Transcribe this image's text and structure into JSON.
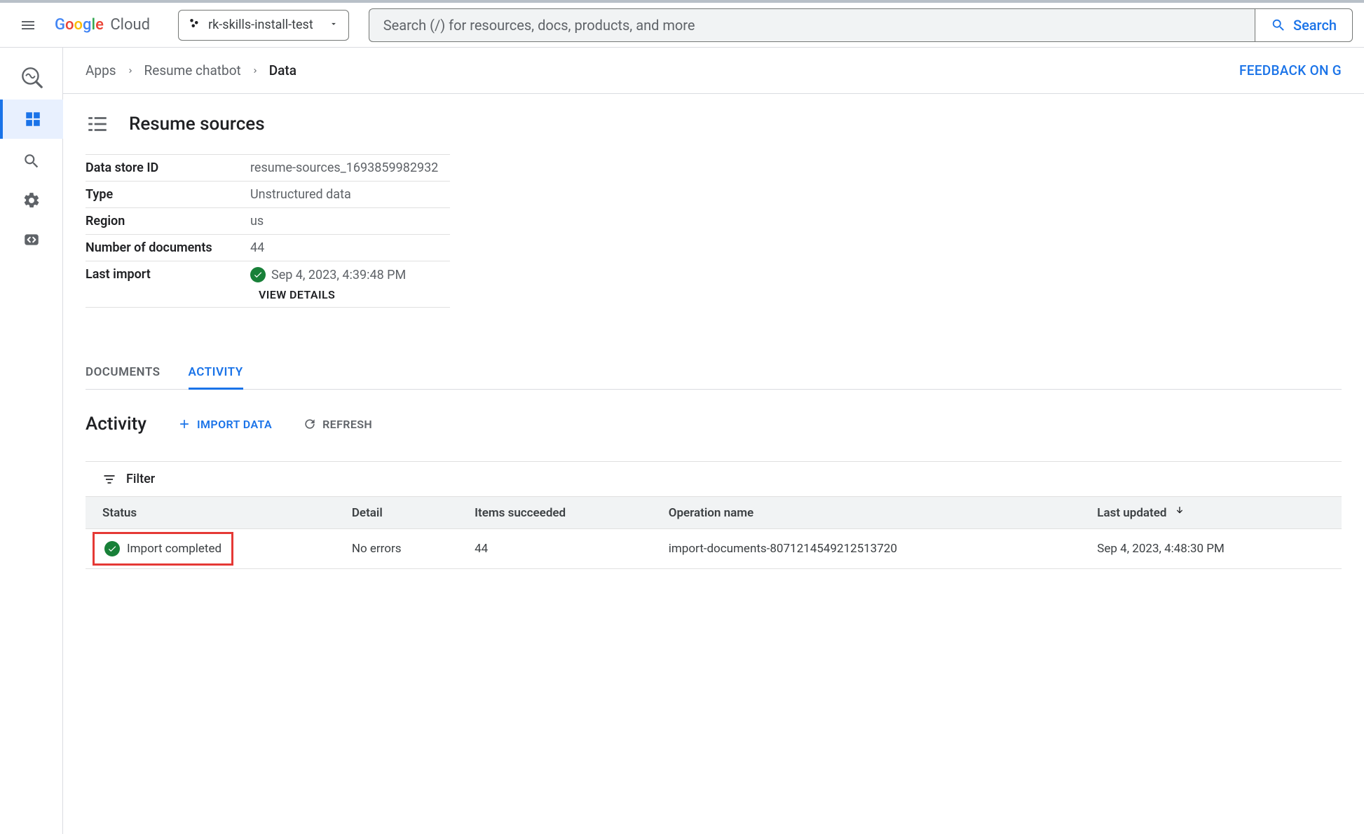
{
  "header": {
    "project_name": "rk-skills-install-test",
    "search_placeholder": "Search (/) for resources, docs, products, and more",
    "search_button": "Search"
  },
  "breadcrumb": {
    "items": [
      "Apps",
      "Resume chatbot",
      "Data"
    ],
    "feedback_label": "FEEDBACK ON G"
  },
  "page": {
    "title": "Resume sources",
    "kv": {
      "data_store_id_label": "Data store ID",
      "data_store_id_value": "resume-sources_1693859982932",
      "type_label": "Type",
      "type_value": "Unstructured data",
      "region_label": "Region",
      "region_value": "us",
      "num_docs_label": "Number of documents",
      "num_docs_value": "44",
      "last_import_label": "Last import",
      "last_import_value": "Sep 4, 2023, 4:39:48 PM",
      "view_details": "VIEW DETAILS"
    }
  },
  "tabs": {
    "documents": "DOCUMENTS",
    "activity": "ACTIVITY"
  },
  "activity": {
    "heading": "Activity",
    "import_data": "IMPORT DATA",
    "refresh": "REFRESH",
    "filter_label": "Filter",
    "columns": {
      "status": "Status",
      "detail": "Detail",
      "items_succeeded": "Items succeeded",
      "operation_name": "Operation name",
      "last_updated": "Last updated"
    },
    "rows": [
      {
        "status": "Import completed",
        "detail": "No errors",
        "items_succeeded": "44",
        "operation_name": "import-documents-8071214549212513720",
        "last_updated": "Sep 4, 2023, 4:48:30 PM"
      }
    ]
  }
}
